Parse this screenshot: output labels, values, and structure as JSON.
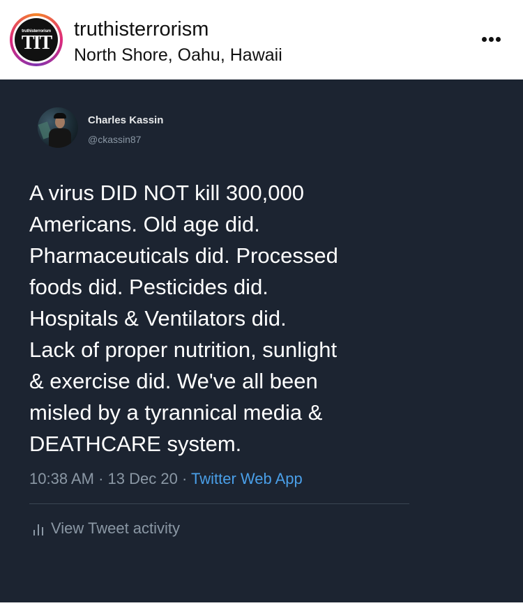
{
  "post_header": {
    "avatar_small_text": "truthisterrorism",
    "avatar_big_text": "TIT",
    "username": "truthisterrorism",
    "location": "North Shore, Oahu, Hawaii",
    "more_icon": "more-dots-icon"
  },
  "tweet": {
    "author_name": "Charles Kassin",
    "author_handle": "@ckassin87",
    "body": "A virus DID NOT kill 300,000\nAmericans. Old age did.\nPharmaceuticals did. Processed\nfoods did. Pesticides did.\nHospitals & Ventilators did.\nLack of proper nutrition, sunlight\n& exercise did. We've all been\nmisled by a tyrannical media &\nDEATHCARE system.",
    "time": "10:38 AM",
    "date": "13 Dec 20",
    "source": "Twitter Web App",
    "separator": "·",
    "activity_label": "View Tweet activity",
    "activity_icon": "bar-chart-icon"
  },
  "colors": {
    "tweet_background": "#1c2431",
    "link": "#4a9fe8",
    "muted_text": "#8b98a5"
  }
}
